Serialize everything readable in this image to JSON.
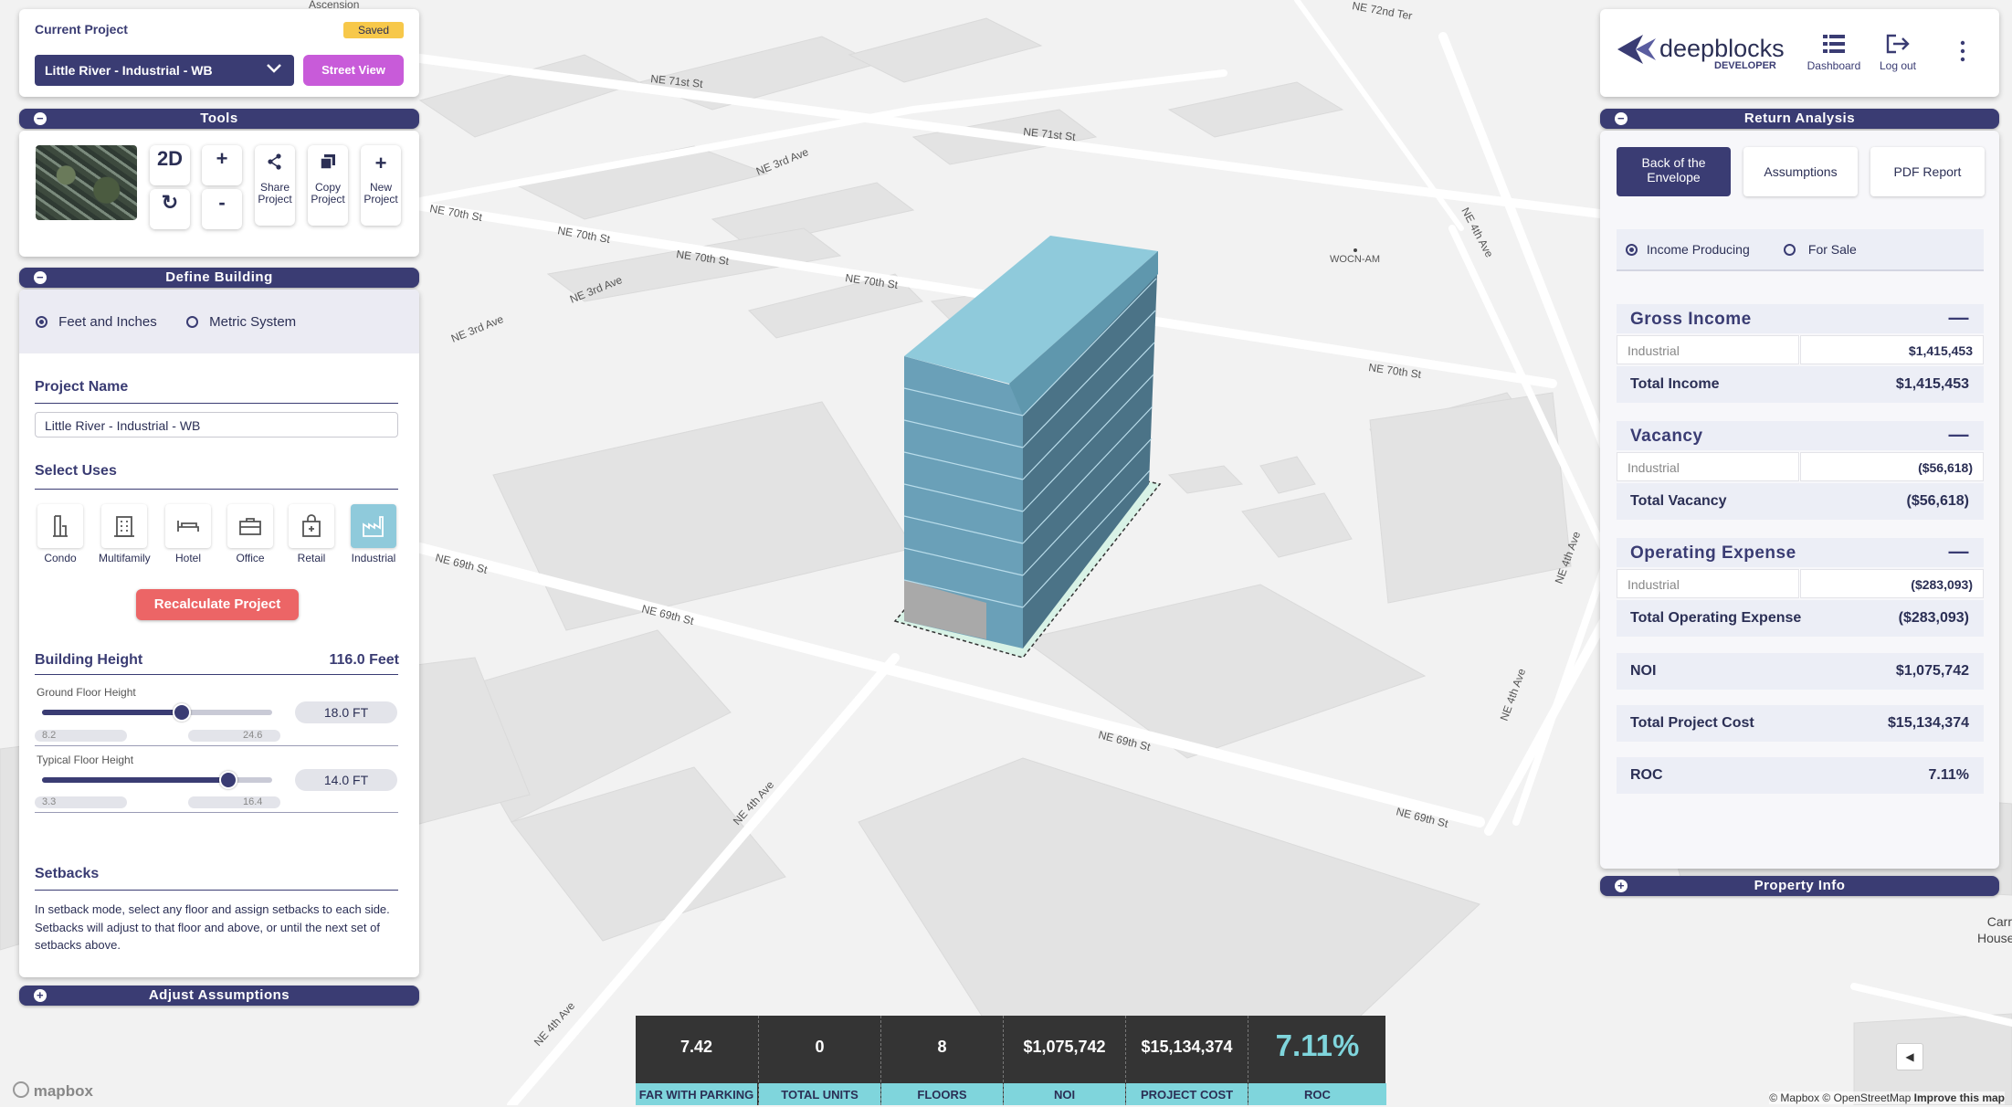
{
  "current_project": {
    "label": "Current Project",
    "status": "Saved",
    "selected": "Little River - Industrial - WB",
    "street_view": "Street View"
  },
  "tools": {
    "title": "Tools",
    "mode_2d": "2D",
    "zoom_in": "+",
    "zoom_out": "-",
    "share": "Share Project",
    "copy": "Copy Project",
    "new": "New Project"
  },
  "define_building": {
    "title": "Define Building",
    "unit_options": [
      "Feet and Inches",
      "Metric System"
    ],
    "selected_unit": "Feet and Inches",
    "project_name_label": "Project Name",
    "project_name_value": "Little River - Industrial - WB",
    "select_uses_label": "Select Uses",
    "uses": [
      "Condo",
      "Multifamily",
      "Hotel",
      "Office",
      "Retail",
      "Industrial"
    ],
    "selected_use": "Industrial",
    "recalculate": "Recalculate Project",
    "building_height_label": "Building Height",
    "building_height_value": "116.0 Feet",
    "ground_floor": {
      "label": "Ground Floor Height",
      "value": "18.0 FT",
      "min": "8.2",
      "max": "24.6",
      "fraction": 0.6
    },
    "typical_floor": {
      "label": "Typical Floor Height",
      "value": "14.0 FT",
      "min": "3.3",
      "max": "16.4",
      "fraction": 0.8
    },
    "setbacks_label": "Setbacks",
    "setbacks_text": "In setback mode, select any floor and assign setbacks to each side. Setbacks will adjust to that floor and above, or until the next set of setbacks above."
  },
  "adjust_assumptions": "Adjust Assumptions",
  "header": {
    "brand": "deepblocks",
    "sub": "DEVELOPER",
    "dashboard": "Dashboard",
    "logout": "Log out"
  },
  "return_analysis": {
    "title": "Return Analysis",
    "tabs": [
      "Back of the Envelope",
      "Assumptions",
      "PDF Report"
    ],
    "mode_options": [
      "Income Producing",
      "For Sale"
    ],
    "selected_mode": "Income Producing",
    "gross_income": {
      "title": "Gross Income",
      "row_label": "Industrial",
      "row_value": "$1,415,453",
      "total_label": "Total Income",
      "total_value": "$1,415,453"
    },
    "vacancy": {
      "title": "Vacancy",
      "row_label": "Industrial",
      "row_value": "($56,618)",
      "total_label": "Total Vacancy",
      "total_value": "($56,618)"
    },
    "operating_expense": {
      "title": "Operating Expense",
      "row_label": "Industrial",
      "row_value": "($283,093)",
      "total_label": "Total Operating Expense",
      "total_value": "($283,093)"
    },
    "noi": {
      "label": "NOI",
      "value": "$1,075,742"
    },
    "project_cost": {
      "label": "Total Project Cost",
      "value": "$15,134,374"
    },
    "roc": {
      "label": "ROC",
      "value": "7.11%"
    }
  },
  "property_info": "Property Info",
  "stats": [
    {
      "value": "7.42",
      "label": "FAR WITH PARKING"
    },
    {
      "value": "0",
      "label": "TOTAL UNITS"
    },
    {
      "value": "8",
      "label": "FLOORS"
    },
    {
      "value": "$1,075,742",
      "label": "NOI"
    },
    {
      "value": "$15,134,374",
      "label": "PROJECT COST"
    },
    {
      "value": "7.11%",
      "label": "ROC"
    }
  ],
  "map": {
    "streets": [
      "NE 71st St",
      "NE 71st St",
      "NE 70th St",
      "NE 70th St",
      "NE 70th St",
      "NE 70th St",
      "NE 70th St",
      "NE 69th St",
      "NE 69th St",
      "NE 69th St",
      "NE 69th St",
      "NE 3rd Ave",
      "NE 3rd Ave",
      "NE 3rd Ave",
      "NE 4th Ave",
      "NE 4th Ave",
      "NE 4th Ave",
      "NE 4th Ave",
      "NE 4th Ave",
      "NE 72nd Ter",
      "Ascension"
    ],
    "poi": "WOCN-AM",
    "poi2": "Carr House",
    "attribution": "© Mapbox © OpenStreetMap",
    "improve": "Improve this map",
    "logo": "mapbox"
  }
}
